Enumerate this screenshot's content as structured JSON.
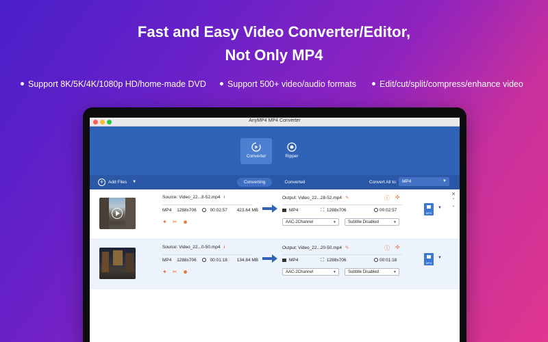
{
  "headline": {
    "line1": "Fast and Easy Video Converter/Editor,",
    "line2": "Not Only MP4"
  },
  "features": [
    "Support 8K/5K/4K/1080p HD/home-made DVD",
    "Support 500+ video/audio formats",
    "Edit/cut/split/compress/enhance video"
  ],
  "window": {
    "title": "AnyMP4 MP4 Converter"
  },
  "nav": {
    "tabs": [
      {
        "label": "Converter",
        "icon": "converter-icon",
        "active": true
      },
      {
        "label": "Ripper",
        "icon": "ripper-icon",
        "active": false
      }
    ]
  },
  "toolbar": {
    "add_files": "Add Files",
    "subtabs": [
      "Converting",
      "Converted"
    ],
    "convert_all_label": "Convert All to:",
    "convert_all_value": "MP4"
  },
  "files": [
    {
      "source": "Source: Video_22...8-52.mp4",
      "format": "MP4",
      "resolution": "1288x706",
      "duration": "00:02:57",
      "size": "423.64 MB",
      "output": "Output: Video_22...28-52.mp4",
      "out_format": "MP4",
      "out_resolution": "1288x706",
      "out_duration": "00:02:57",
      "audio": "AAC-2Channel",
      "subtitle": "Subtitle Disabled",
      "profile_badge": "MP4"
    },
    {
      "source": "Source: Video_22...0-50.mp4",
      "format": "MP4",
      "resolution": "1288x706",
      "duration": "00:01:18",
      "size": "134.84 MB",
      "output": "Output: Video_22...20-50.mp4",
      "out_format": "MP4",
      "out_resolution": "1288x706",
      "out_duration": "00:01:18",
      "audio": "AAC-2Channel",
      "subtitle": "Subtitle Disabled",
      "profile_badge": "MP4"
    }
  ],
  "colors": {
    "accent": "#2f63b8",
    "highlight": "#e46b2b"
  }
}
